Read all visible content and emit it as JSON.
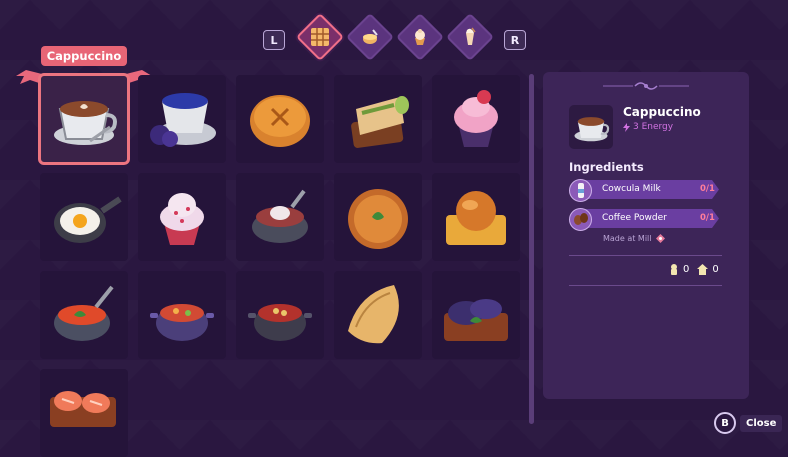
{
  "tabs": {
    "left_shoulder": "L",
    "right_shoulder": "R",
    "items": [
      {
        "icon": "grid-icon",
        "active": true
      },
      {
        "icon": "cooking-pot-icon",
        "active": false
      },
      {
        "icon": "cupcake-icon",
        "active": false
      },
      {
        "icon": "drink-icon",
        "active": false
      }
    ]
  },
  "tooltip": "Cappuccino",
  "recipes": [
    {
      "icon": "cappuccino-icon",
      "selected": true
    },
    {
      "icon": "blueberry-coffee-icon"
    },
    {
      "icon": "bread-icon"
    },
    {
      "icon": "wrap-sandwich-icon"
    },
    {
      "icon": "berry-cupcake-icon"
    },
    {
      "icon": "fried-egg-pan-icon"
    },
    {
      "icon": "sprinkle-cupcake-icon"
    },
    {
      "icon": "soup-bowl-icon"
    },
    {
      "icon": "pizza-icon"
    },
    {
      "icon": "toast-bun-icon"
    },
    {
      "icon": "tomato-soup-icon"
    },
    {
      "icon": "stew-pot-icon"
    },
    {
      "icon": "bean-stew-pot-icon"
    },
    {
      "icon": "pastry-icon"
    },
    {
      "icon": "eggplant-toast-icon"
    },
    {
      "icon": "salmon-toast-icon"
    }
  ],
  "detail": {
    "name": "Cappuccino",
    "energy": "3 Energy",
    "ingredients_title": "Ingredients",
    "ingredients": [
      {
        "name": "Cowcula Milk",
        "count": "0/1",
        "icon": "milk-bottle-icon"
      },
      {
        "name": "Coffee Powder",
        "count": "0/1",
        "icon": "coffee-beans-icon"
      }
    ],
    "made_at": "Made at Mill",
    "counter_a": "0",
    "counter_b": "0"
  },
  "close": {
    "button": "B",
    "label": "Close"
  }
}
